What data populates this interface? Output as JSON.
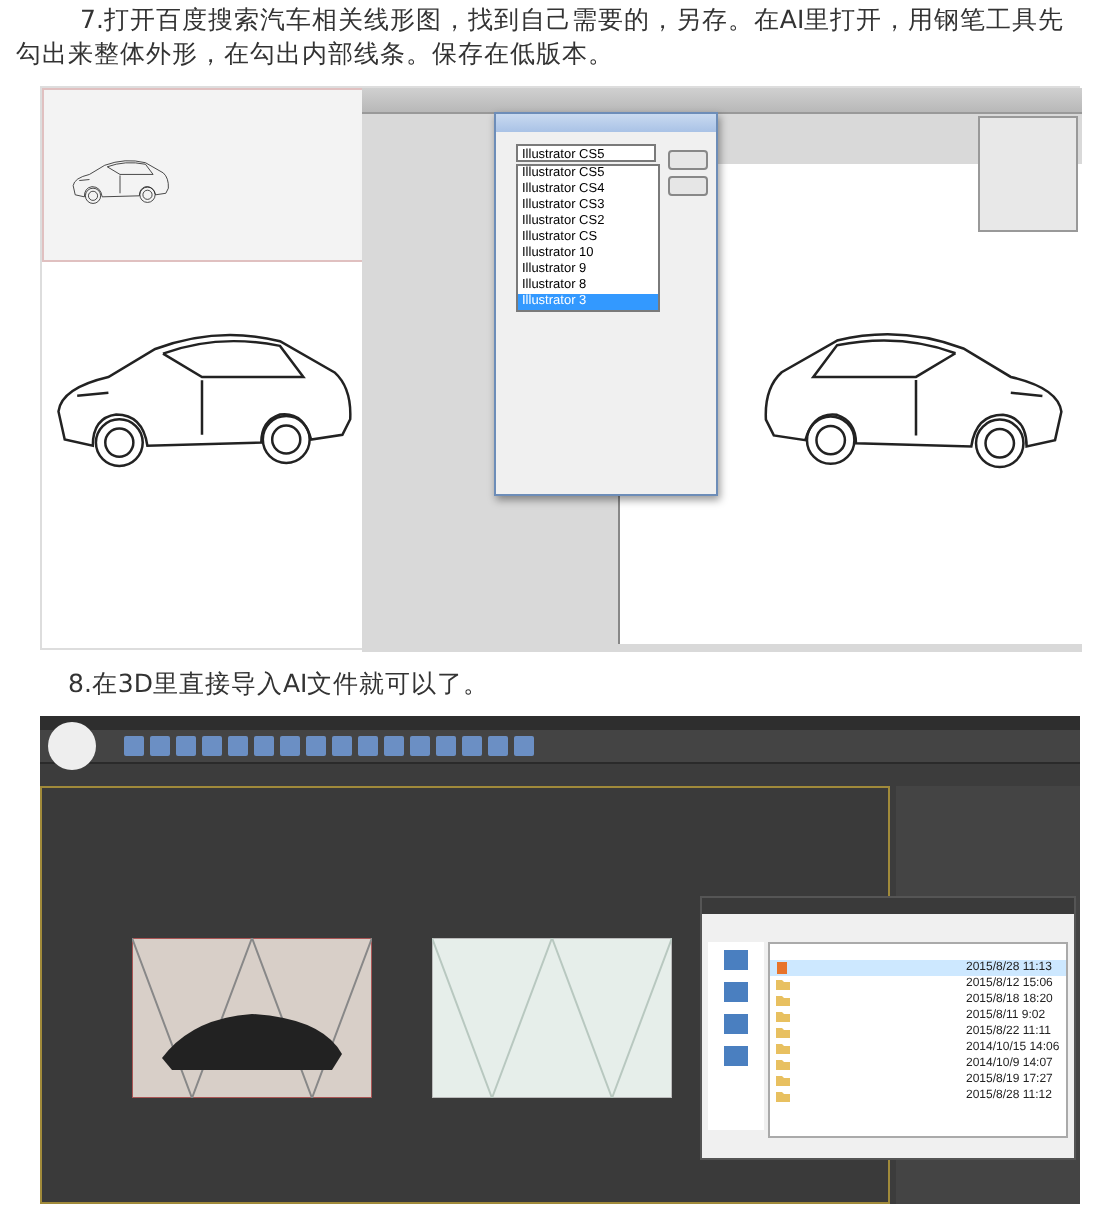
{
  "step7": {
    "text": "7.打开百度搜索汽车相关线形图，找到自己需要的，另存。在AI里打开，用钢笔工具先勾出来整体外形，在勾出内部线条。保存在低版本。"
  },
  "screenshot_ai": {
    "dialog": {
      "version_value": "Illustrator CS5",
      "versions": [
        {
          "label": "Illustrator CS5",
          "selected": false
        },
        {
          "label": "Illustrator CS4",
          "selected": false
        },
        {
          "label": "Illustrator CS3",
          "selected": false
        },
        {
          "label": "Illustrator CS2",
          "selected": false
        },
        {
          "label": "Illustrator CS",
          "selected": false
        },
        {
          "label": "Illustrator 10",
          "selected": false
        },
        {
          "label": "Illustrator 9",
          "selected": false
        },
        {
          "label": "Illustrator 8",
          "selected": false
        },
        {
          "label": "Illustrator 3",
          "selected": true
        }
      ]
    }
  },
  "step8": {
    "text": "8.在3D里直接导入AI文件就可以了。"
  },
  "screenshot_max": {
    "file_dialog": {
      "files": [
        {
          "kind": "ai",
          "date": "2015/8/28 11:13",
          "selected": true
        },
        {
          "kind": "folder",
          "date": "2015/8/12 15:06",
          "selected": false
        },
        {
          "kind": "folder",
          "date": "2015/8/18 18:20",
          "selected": false
        },
        {
          "kind": "folder",
          "date": "2015/8/11 9:02",
          "selected": false
        },
        {
          "kind": "folder",
          "date": "2015/8/22 11:11",
          "selected": false
        },
        {
          "kind": "folder",
          "date": "2014/10/15 14:06",
          "selected": false
        },
        {
          "kind": "folder",
          "date": "2014/10/9 14:07",
          "selected": false
        },
        {
          "kind": "folder",
          "date": "2015/8/19 17:27",
          "selected": false
        },
        {
          "kind": "folder",
          "date": "2015/8/28 11:12",
          "selected": false
        }
      ]
    }
  }
}
